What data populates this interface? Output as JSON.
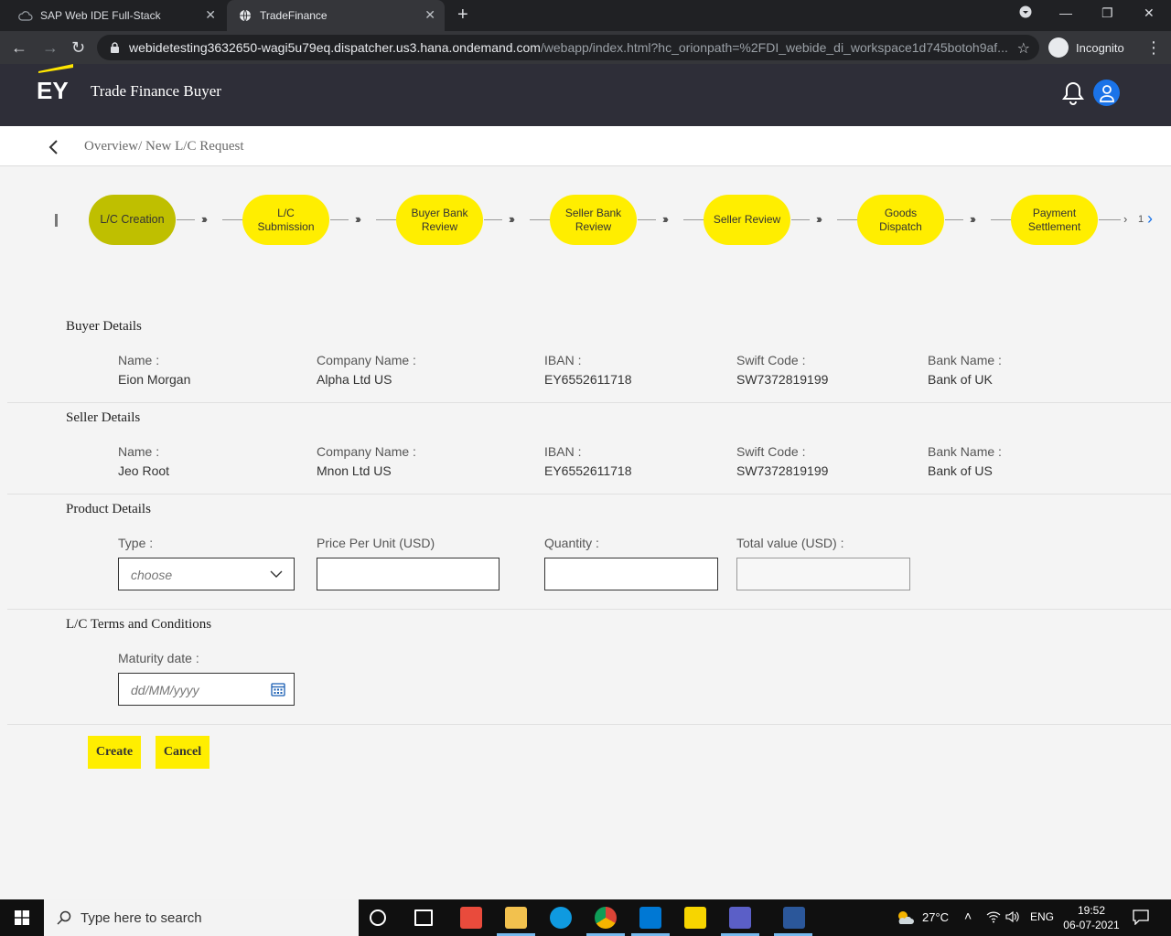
{
  "browser": {
    "tabs": [
      {
        "title": "SAP Web IDE Full-Stack",
        "active": false
      },
      {
        "title": "TradeFinance",
        "active": true
      }
    ],
    "url_host": "webidetesting3632650-wagi5u79eq.dispatcher.us3.hana.ondemand.com",
    "url_path": "/webapp/index.html?hc_orionpath=%2FDI_webide_di_workspace1d745botoh9af...",
    "incognito_label": "Incognito"
  },
  "app": {
    "logo_text": "EY",
    "title": "Trade Finance Buyer"
  },
  "breadcrumb": "Overview/ New L/C Request",
  "steps": [
    {
      "label": "L/C Creation",
      "current": true
    },
    {
      "label": "L/C Submission",
      "current": false
    },
    {
      "label": "Buyer Bank Review",
      "current": false
    },
    {
      "label": "Seller Bank Review",
      "current": false
    },
    {
      "label": "Seller Review",
      "current": false
    },
    {
      "label": "Goods Dispatch",
      "current": false
    },
    {
      "label": "Payment Settlement",
      "current": false
    }
  ],
  "steps_page": "1",
  "buyer": {
    "title": "Buyer Details",
    "name_label": "Name :",
    "name": "Eion Morgan",
    "company_label": "Company Name :",
    "company": "Alpha Ltd US",
    "iban_label": "IBAN :",
    "iban": "EY6552611718",
    "swift_label": "Swift Code :",
    "swift": "SW7372819199",
    "bank_label": "Bank Name :",
    "bank": "Bank of UK"
  },
  "seller": {
    "title": "Seller Details",
    "name_label": "Name :",
    "name": "Jeo Root",
    "company_label": "Company Name :",
    "company": "Mnon Ltd US",
    "iban_label": "IBAN :",
    "iban": "EY6552611718",
    "swift_label": "Swift Code :",
    "swift": "SW7372819199",
    "bank_label": "Bank Name :",
    "bank": "Bank of US"
  },
  "product": {
    "title": "Product Details",
    "type_label": "Type :",
    "type_placeholder": "choose",
    "price_label": "Price Per Unit (USD)",
    "price_value": "",
    "qty_label": "Quantity :",
    "qty_value": "",
    "total_label": "Total value (USD) :",
    "total_value": ""
  },
  "terms": {
    "title": "L/C Terms and Conditions",
    "maturity_label": "Maturity date :",
    "maturity_placeholder": "dd/MM/yyyy"
  },
  "actions": {
    "create": "Create",
    "cancel": "Cancel"
  },
  "taskbar": {
    "search_placeholder": "Type here to search",
    "weather": "27°C",
    "lang": "ENG",
    "time": "19:52",
    "date": "06-07-2021"
  },
  "colors": {
    "accent": "#ffee00",
    "accent_dark": "#bfbf00",
    "header_bg": "#2e2e38"
  }
}
